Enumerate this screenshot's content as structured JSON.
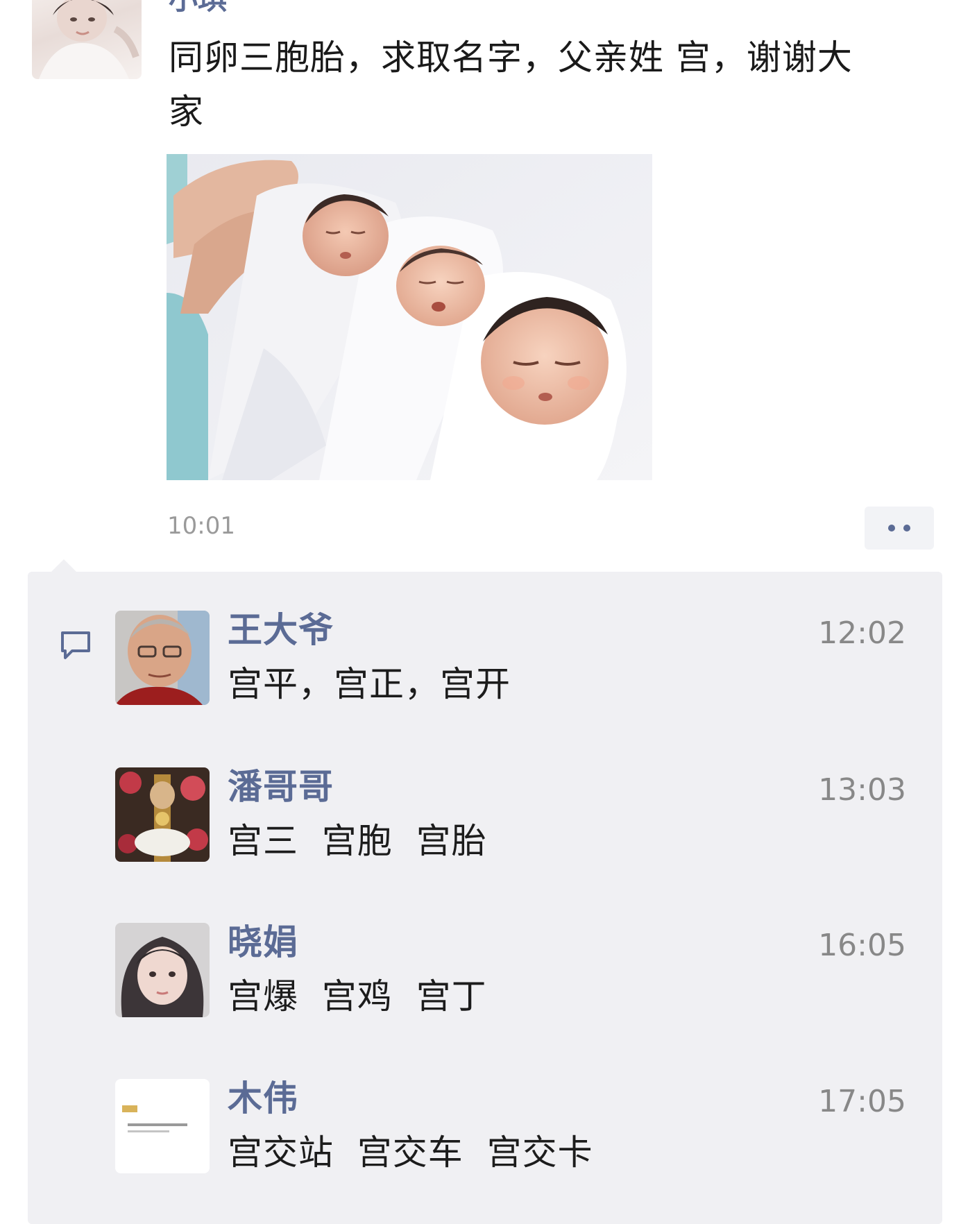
{
  "post": {
    "author": "小琪",
    "text": "同卵三胞胎，求取名字，父亲姓 宫，谢谢大家",
    "image_alt": "three swaddled newborn babies",
    "time": "10:01"
  },
  "actions": {
    "more_icon": "more-dots-icon"
  },
  "comments": [
    {
      "name": "王大爷",
      "text": "宫平，宫正，宫开",
      "time": "12:02"
    },
    {
      "name": "潘哥哥",
      "text": "宫三  宫胞  宫胎",
      "time": "13:03"
    },
    {
      "name": "晓娟",
      "text": "宫爆  宫鸡  宫丁",
      "time": "16:05"
    },
    {
      "name": "木伟",
      "text": "宫交站  宫交车  宫交卡",
      "time": "17:05"
    }
  ],
  "colors": {
    "name_link": "#5b6b95",
    "panel_bg": "#f0f0f3",
    "time_gray": "#9a9a9a"
  }
}
